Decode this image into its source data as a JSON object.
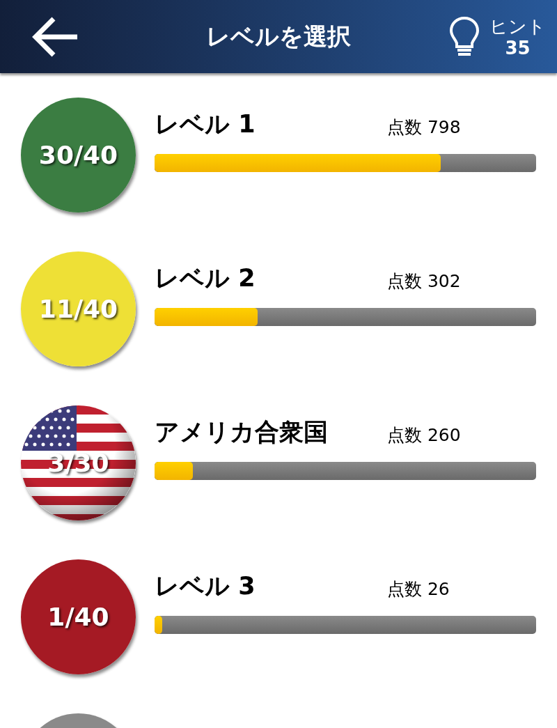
{
  "header": {
    "title": "レベルを選択",
    "hint_label": "ヒント",
    "hint_count": "35"
  },
  "levels": [
    {
      "kind": "color",
      "color": "#3b7d42",
      "progress": "30/40",
      "title": "レベル 1",
      "score": "点数 798",
      "level": 0.75
    },
    {
      "kind": "color",
      "color": "#eee036",
      "progress": "11/40",
      "title": "レベル 2",
      "score": "点数 302",
      "level": 0.27
    },
    {
      "kind": "flag",
      "progress": "3/30",
      "title": "アメリカ合衆国",
      "score": "点数 260",
      "level": 0.1
    },
    {
      "kind": "color",
      "color": "#a51a24",
      "progress": "1/40",
      "title": "レベル 3",
      "score": "点数 26",
      "level": 0.02
    },
    {
      "kind": "color",
      "color": "#8a8a8a"
    }
  ]
}
